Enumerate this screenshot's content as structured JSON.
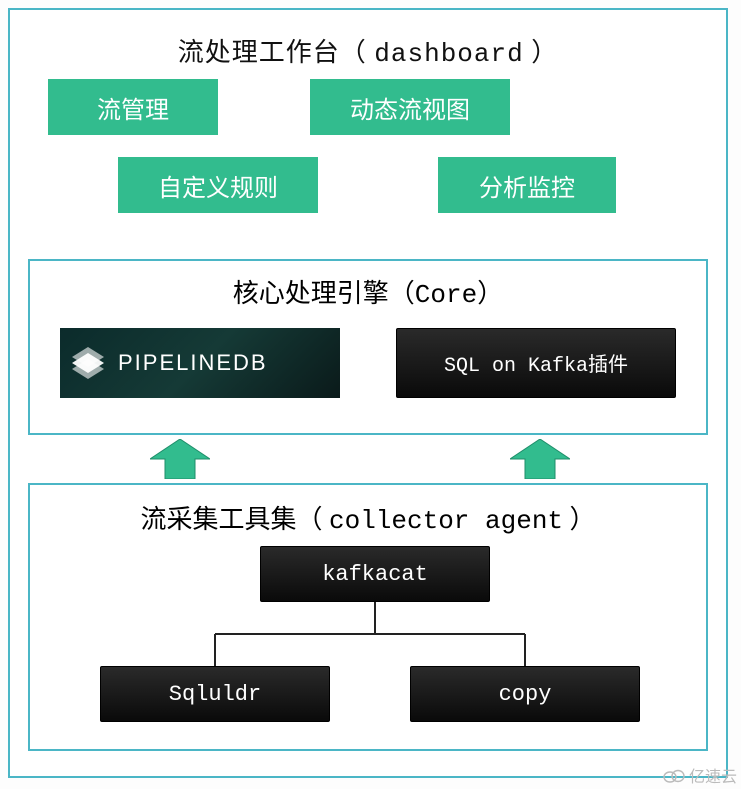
{
  "dashboard": {
    "title_cn": "流处理工作台",
    "title_en": "dashboard",
    "boxes": {
      "stream_mgmt": "流管理",
      "dynamic_view": "动态流视图",
      "custom_rules": "自定义规则",
      "analytics": "分析监控"
    }
  },
  "core": {
    "title_cn": "核心处理引擎",
    "title_en": "Core",
    "pipelinedb_label": "PIPELINEDB",
    "sql_kafka_label": "SQL on Kafka插件"
  },
  "collector": {
    "title_cn": "流采集工具集",
    "title_en": "collector agent",
    "kafkacat": "kafkacat",
    "sqluldr": "Sqluldr",
    "copy": "copy"
  },
  "watermark": "亿速云",
  "colors": {
    "green": "#32bc8e",
    "border": "#4bb6c6",
    "black": "#1a1a1a"
  }
}
